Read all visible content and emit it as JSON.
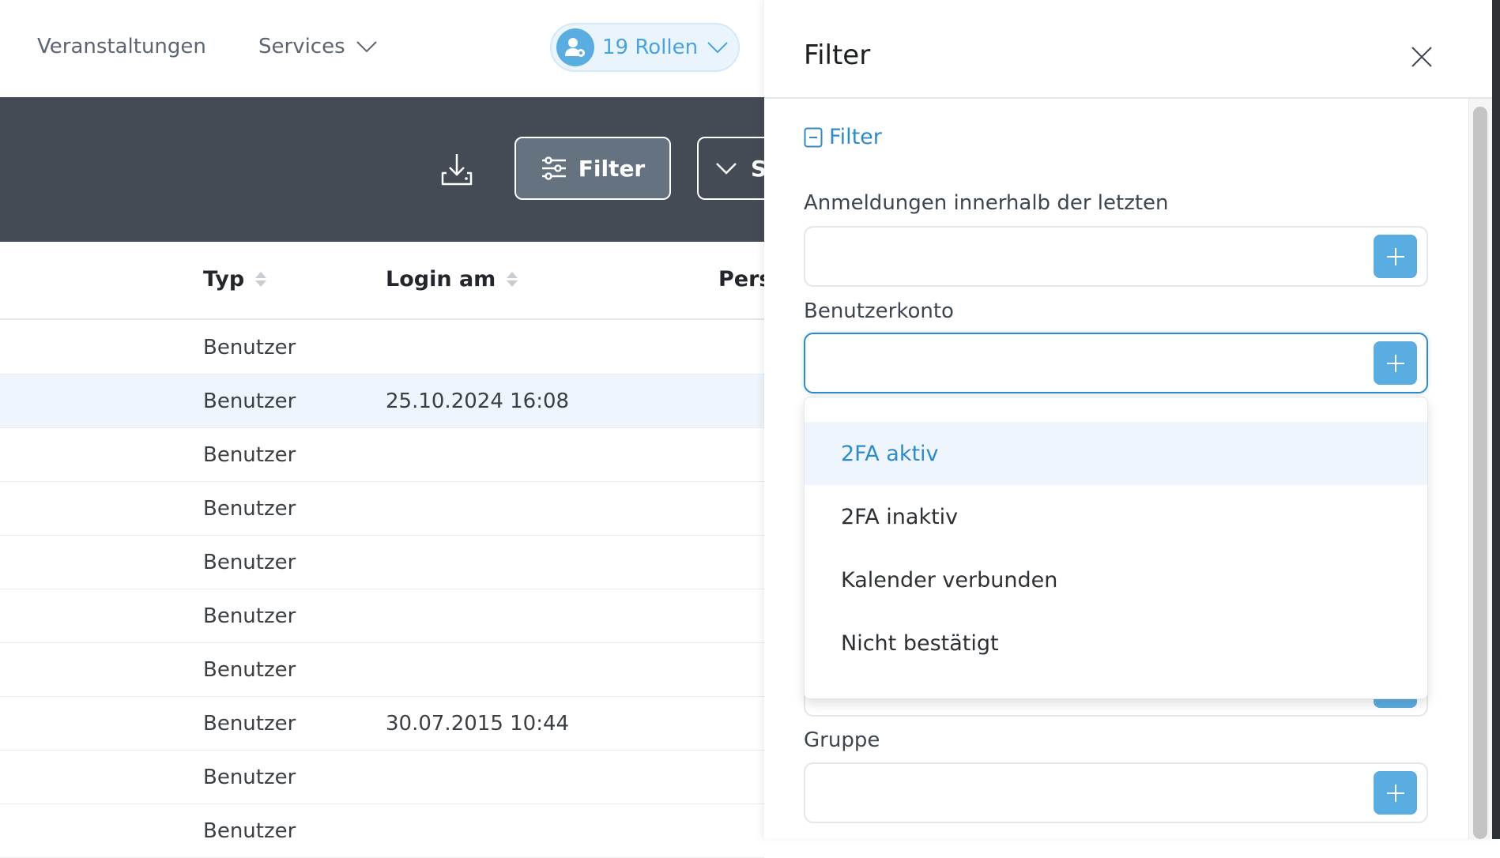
{
  "nav": {
    "items": [
      {
        "label": "Veranstaltungen"
      },
      {
        "label": "Services",
        "icon": "chevron-down-icon"
      }
    ],
    "roles": {
      "label": "19 Rollen",
      "icon": "user-gear-icon"
    }
  },
  "toolbar": {
    "download_icon": "download-icon",
    "filter_label": "Filter",
    "next_label": "S"
  },
  "table": {
    "columns": [
      "Typ",
      "Login am",
      "Pers"
    ],
    "rows": [
      {
        "typ": "Benutzer",
        "login": ""
      },
      {
        "typ": "Benutzer",
        "login": "25.10.2024 16:08"
      },
      {
        "typ": "Benutzer",
        "login": ""
      },
      {
        "typ": "Benutzer",
        "login": ""
      },
      {
        "typ": "Benutzer",
        "login": ""
      },
      {
        "typ": "Benutzer",
        "login": ""
      },
      {
        "typ": "Benutzer",
        "login": ""
      },
      {
        "typ": "Benutzer",
        "login": "30.07.2015 10:44"
      },
      {
        "typ": "Benutzer",
        "login": ""
      },
      {
        "typ": "Benutzer",
        "login": ""
      }
    ]
  },
  "panel": {
    "title": "Filter",
    "toggle_label": "Filter",
    "fields": [
      {
        "label": "Anmeldungen innerhalb der letzten",
        "value": ""
      },
      {
        "label": "Benutzerkonto",
        "value": ""
      },
      {
        "label": "Gruppe",
        "value": ""
      }
    ],
    "dropdown": {
      "options": [
        "2FA aktiv",
        "2FA inaktiv",
        "Kalender verbunden",
        "Nicht bestätigt"
      ],
      "active": "2FA aktiv"
    }
  },
  "colors": {
    "accent": "#2f8bc8",
    "button": "#5aade0",
    "band": "#444b54"
  }
}
